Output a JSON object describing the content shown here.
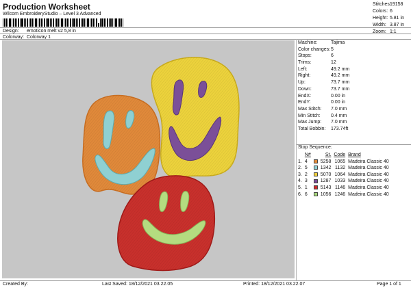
{
  "header": {
    "title": "Production Worksheet",
    "software": "Wilcom EmbroideryStudio – Level 3 Advanced",
    "design_label": "Design:",
    "design_value": "emoticon melt v2 5,8 in",
    "colorway_label": "Colorway:",
    "colorway_value": "Colorway 1"
  },
  "summary": [
    {
      "label": "Stitches:",
      "value": "19158"
    },
    {
      "label": "Colors:",
      "value": "6"
    },
    {
      "label": "Height:",
      "value": "5.81 in"
    },
    {
      "label": "Width:",
      "value": "3.87 in"
    },
    {
      "label": "Zoom:",
      "value": "1:1"
    }
  ],
  "stats": [
    {
      "label": "Machine:",
      "value": "Tajima"
    },
    {
      "label": "Color changes:",
      "value": "5"
    },
    {
      "label": "Stops:",
      "value": "6"
    },
    {
      "label": "Trims:",
      "value": "12"
    },
    {
      "label": "Left:",
      "value": "49.2 mm"
    },
    {
      "label": "Right:",
      "value": "49.2 mm"
    },
    {
      "label": "Up:",
      "value": "73.7 mm"
    },
    {
      "label": "Down:",
      "value": "73.7 mm"
    },
    {
      "label": "EndX:",
      "value": "0.00 in"
    },
    {
      "label": "EndY:",
      "value": "0.00 in"
    },
    {
      "label": "Max Stitch:",
      "value": "7.0 mm"
    },
    {
      "label": "Min Stitch:",
      "value": "0.4 mm"
    },
    {
      "label": "Max Jump:",
      "value": "7.0 mm"
    },
    {
      "label": "Total Bobbin:",
      "value": "173.74ft"
    }
  ],
  "stop_sequence": {
    "title": "Stop Sequence:",
    "columns": [
      "",
      "N#",
      "",
      "St.",
      "Code",
      "Brand"
    ],
    "rows": [
      {
        "idx": "1.",
        "n": "4",
        "color": "#e0893a",
        "st": "5258",
        "code": "1065",
        "brand": "Madeira Classic 40"
      },
      {
        "idx": "2.",
        "n": "5",
        "color": "#8ecfd4",
        "st": "1342",
        "code": "1132",
        "brand": "Madeira Classic 40"
      },
      {
        "idx": "3.",
        "n": "2",
        "color": "#f0cf3c",
        "st": "5070",
        "code": "1064",
        "brand": "Madeira Classic 40"
      },
      {
        "idx": "4.",
        "n": "3",
        "color": "#7a4c98",
        "st": "1287",
        "code": "1033",
        "brand": "Madeira Classic 40"
      },
      {
        "idx": "5.",
        "n": "1",
        "color": "#cc2a2a",
        "st": "5143",
        "code": "1146",
        "brand": "Madeira Classic 40"
      },
      {
        "idx": "6.",
        "n": "6",
        "color": "#a6d77a",
        "st": "1056",
        "code": "1246",
        "brand": "Madeira Classic 40"
      }
    ]
  },
  "footer": {
    "created_by": "Created By:",
    "last_saved": "Last Saved: 18/12/2021 03.22.05",
    "printed": "Printed: 18/12/2021 03.22.07",
    "page": "Page 1 of 1"
  },
  "colors": {
    "orange": "#e0893a",
    "yellow": "#ecd23c",
    "red": "#c8302c",
    "light_blue": "#8fd0d2",
    "purple": "#7b4f98",
    "light_green": "#b4dc80",
    "canvas": "#c6c6c6"
  }
}
